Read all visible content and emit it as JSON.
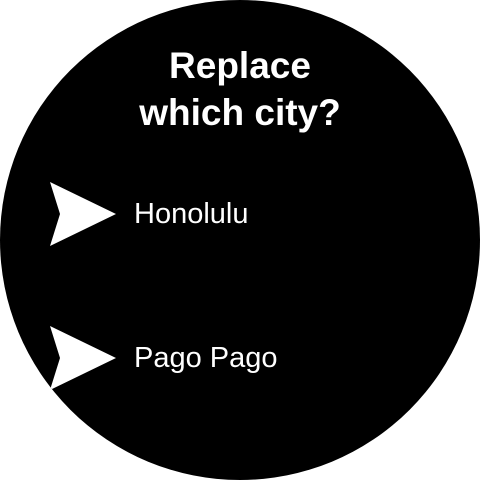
{
  "dialog": {
    "title_line1": "Replace",
    "title_line2": "which city?"
  },
  "cities": [
    {
      "label": "Honolulu",
      "icon": "send-arrow-icon"
    },
    {
      "label": "Pago Pago",
      "icon": "send-arrow-icon"
    }
  ],
  "colors": {
    "background": "#000000",
    "text": "#ffffff",
    "icon": "#ffffff"
  }
}
